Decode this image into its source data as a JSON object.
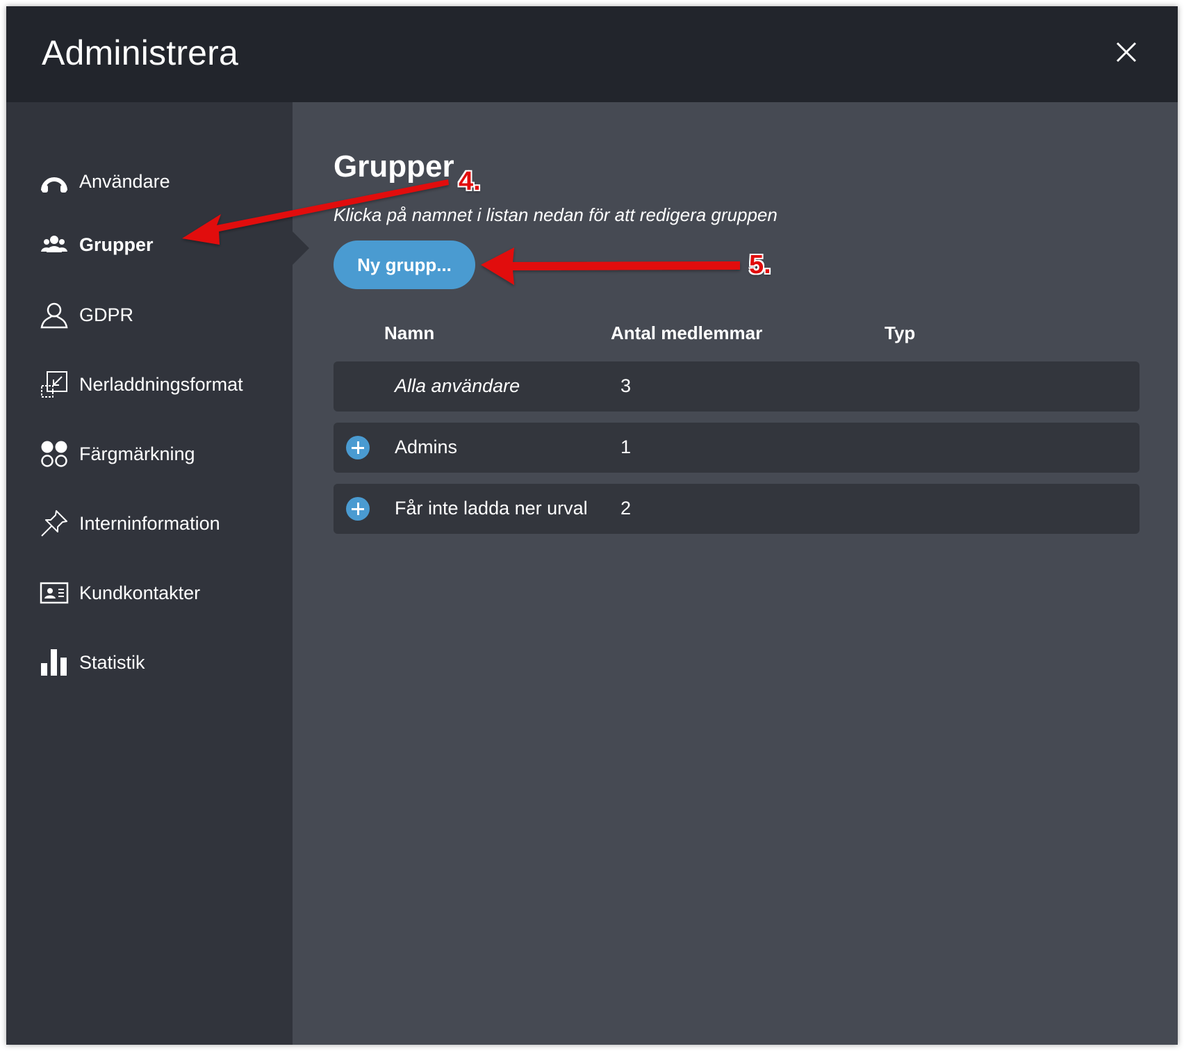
{
  "window": {
    "title": "Administrera"
  },
  "sidebar": {
    "items": [
      {
        "label": "Användare",
        "icon": "user-circle-icon"
      },
      {
        "label": "Grupper",
        "icon": "group-icon",
        "active": true
      },
      {
        "label": "GDPR",
        "icon": "person-outline-icon"
      },
      {
        "label": "Nerladdningsformat",
        "icon": "download-format-icon"
      },
      {
        "label": "Färgmärkning",
        "icon": "color-circles-icon"
      },
      {
        "label": "Interninformation",
        "icon": "pin-icon"
      },
      {
        "label": "Kundkontakter",
        "icon": "contact-card-icon"
      },
      {
        "label": "Statistik",
        "icon": "bar-chart-icon"
      }
    ]
  },
  "main": {
    "title": "Grupper",
    "subtitle": "Klicka på namnet i listan nedan för att redigera gruppen",
    "new_group_label": "Ny grupp...",
    "columns": [
      "Namn",
      "Antal medlemmar",
      "Typ"
    ],
    "rows": [
      {
        "name": "Alla användare",
        "count": "3",
        "expandable": false
      },
      {
        "name": "Admins",
        "count": "1",
        "expandable": true
      },
      {
        "name": "Får inte ladda ner urval",
        "count": "2",
        "expandable": true
      }
    ]
  },
  "annotations": {
    "step4": "4.",
    "step5": "5."
  },
  "colors": {
    "header": "#22252c",
    "sidebar": "#31343c",
    "content": "#464a53",
    "row": "#33363d",
    "accent": "#4a9bd1",
    "annotation": "#e10b0b"
  }
}
